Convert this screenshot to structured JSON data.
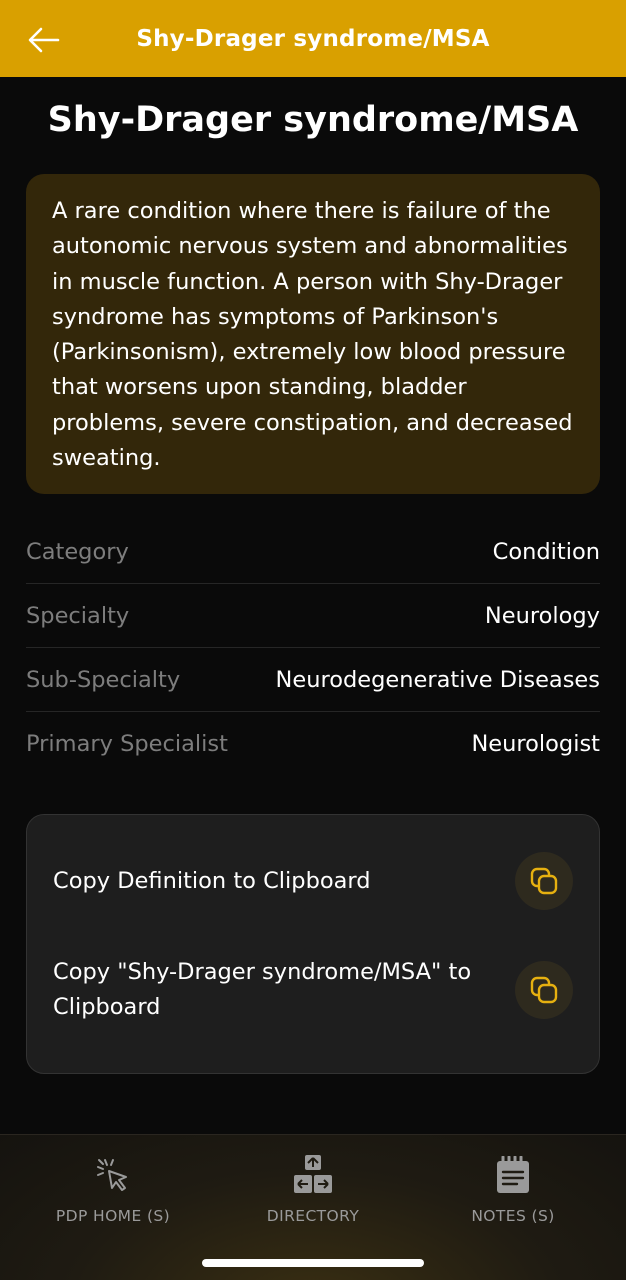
{
  "header": {
    "title": "Shy-Drager syndrome/MSA",
    "back_icon": "arrow-left-icon"
  },
  "page_title": "Shy-Drager syndrome/MSA",
  "definition": "A rare condition where there is failure of the autonomic nervous system and abnormalities in muscle function. A person with Shy-Drager syndrome has symptoms of Parkinson's (Parkinsonism), extremely low blood pressure that worsens upon standing, bladder problems, severe constipation, and decreased sweating.",
  "details": [
    {
      "label": "Category",
      "value": "Condition"
    },
    {
      "label": "Specialty",
      "value": "Neurology"
    },
    {
      "label": "Sub-Specialty",
      "value": "Neurodegenerative Diseases"
    },
    {
      "label": "Primary Specialist",
      "value": "Neurologist"
    }
  ],
  "actions": [
    {
      "label": "Copy Definition to Clipboard",
      "icon": "copy-icon"
    },
    {
      "label": "Copy \"Shy-Drager syndrome/MSA\" to Clipboard",
      "icon": "copy-icon"
    }
  ],
  "nav": [
    {
      "label": "PDP HOME (S)",
      "icon": "cursor-click-icon"
    },
    {
      "label": "DIRECTORY",
      "icon": "arrow-keys-icon"
    },
    {
      "label": "NOTES (S)",
      "icon": "notepad-icon"
    }
  ],
  "colors": {
    "accent": "#d9a000",
    "background": "#0a0a0a",
    "definition_card": "#33270a",
    "actions_card": "#1e1e1e",
    "copy_icon": "#e6b010"
  }
}
